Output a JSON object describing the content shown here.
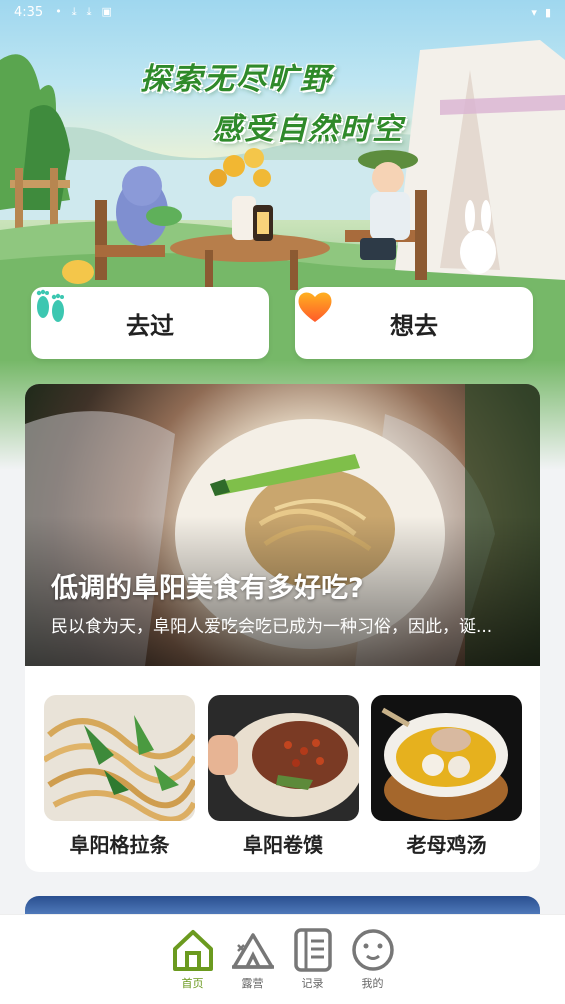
{
  "status_bar": {
    "time": "4:35"
  },
  "hero": {
    "slogan_line1": "探索无尽旷野",
    "slogan_line2": "感受自然时空",
    "buttons": [
      {
        "label": "去过",
        "icon": "footprints-icon"
      },
      {
        "label": "想去",
        "icon": "heart-icon"
      }
    ]
  },
  "feature": {
    "title": "低调的阜阳美食有多好吃?",
    "description": "民以食为天，阜阳人爱吃会吃已成为一种习俗，因此，诞..."
  },
  "foods": [
    {
      "name": "阜阳格拉条"
    },
    {
      "name": "阜阳卷馍"
    },
    {
      "name": "老母鸡汤"
    }
  ],
  "tabbar": {
    "tabs": [
      {
        "label": "首页",
        "icon": "home-icon",
        "active": true
      },
      {
        "label": "露营",
        "icon": "tent-icon",
        "active": false
      },
      {
        "label": "记录",
        "icon": "notebook-icon",
        "active": false
      },
      {
        "label": "我的",
        "icon": "face-icon",
        "active": false
      }
    ]
  },
  "colors": {
    "accent": "#6b9a1f",
    "slogan_green": "#2f8a2a"
  }
}
